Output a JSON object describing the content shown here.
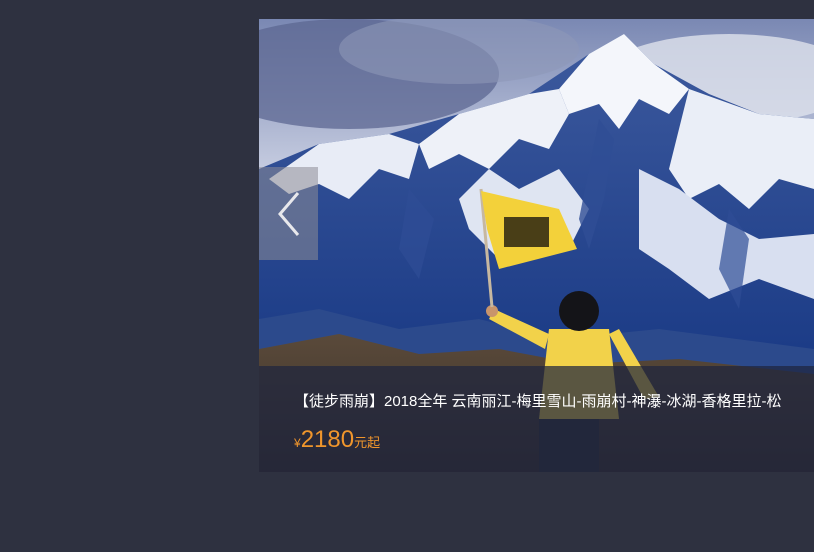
{
  "product": {
    "title": "【徒步雨崩】2018全年 云南丽江-梅里雪山-雨崩村-神瀑-冰湖-香格里拉-松",
    "price": {
      "currency": "¥",
      "amount": "2180",
      "suffix": "元起"
    }
  },
  "icons": {
    "prev": "chevron-left-icon"
  },
  "colors": {
    "background": "#2e3140",
    "price": "#f0962c",
    "caption_bg": "#1e263e"
  }
}
